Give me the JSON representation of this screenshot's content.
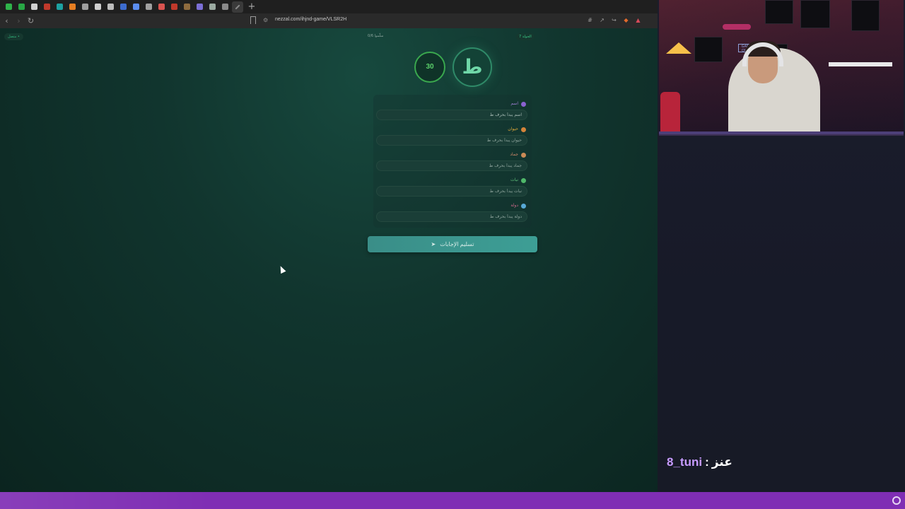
{
  "browser": {
    "tabs": [
      {
        "name": "tab-1",
        "color": "#2fb34a"
      },
      {
        "name": "tab-2",
        "color": "#28a745"
      },
      {
        "name": "tab-3",
        "color": "#d0d0d0"
      },
      {
        "name": "tab-4",
        "color": "#c0392b"
      },
      {
        "name": "tab-5",
        "color": "#1da1a1"
      },
      {
        "name": "tab-6",
        "color": "#e67e22"
      },
      {
        "name": "tab-7",
        "color": "#9e9e9e"
      },
      {
        "name": "tab-8",
        "color": "#cfcfcf"
      },
      {
        "name": "tab-9",
        "color": "#bdbdbd"
      },
      {
        "name": "tab-10",
        "color": "#3d6ccf"
      },
      {
        "name": "tab-11",
        "color": "#5b8def"
      },
      {
        "name": "tab-12",
        "color": "#a0a0a0"
      },
      {
        "name": "tab-13",
        "color": "#d9534f"
      },
      {
        "name": "tab-14",
        "color": "#c0392b"
      },
      {
        "name": "tab-15",
        "color": "#8e6b3e"
      },
      {
        "name": "tab-16",
        "color": "#7b6fd6"
      },
      {
        "name": "tab-17",
        "color": "#9aa9a0"
      },
      {
        "name": "tab-18",
        "color": "#8a8a8a"
      },
      {
        "name": "tab-19",
        "color": "#bdbdbd"
      }
    ],
    "url": "nezzal.com/ihjnd-game/VLSR2H"
  },
  "game": {
    "connection_status": "متصل",
    "players_submitted": "0/6 سلّموا",
    "round_label": "الجولة 7",
    "timer": "30",
    "letter": "ط",
    "fields": [
      {
        "label": "اسم",
        "icon": "👤",
        "label_color": "#a07fd6",
        "icon_color": "#8a62d0",
        "placeholder": "اسم يبدأ بحرف ط",
        "value": "اسم يبدأ بحرف ط"
      },
      {
        "label": "حيوان",
        "icon": "🐾",
        "label_color": "#e0a93a",
        "icon_color": "#d4843a",
        "placeholder": "حيوان يبدأ بحرف ط",
        "value": ""
      },
      {
        "label": "جماد",
        "icon": "📦",
        "label_color": "#d58a6a",
        "icon_color": "#c98a56",
        "placeholder": "جماد يبدأ بحرف ط",
        "value": ""
      },
      {
        "label": "نبات",
        "icon": "🌿",
        "label_color": "#5fc07a",
        "icon_color": "#4fb86a",
        "placeholder": "نبات يبدأ بحرف ط",
        "value": ""
      },
      {
        "label": "دولة",
        "icon": "🌍",
        "label_color": "#d06a8c",
        "icon_color": "#58a9d6",
        "placeholder": "دولة يبدأ بحرف ط",
        "value": ""
      }
    ],
    "submit_label": "تسليم الإجابات"
  },
  "stream": {
    "chat_user": "8_tuni",
    "chat_separator": ":",
    "chat_message": "عنز",
    "cam_sign": "GAME OVER"
  }
}
